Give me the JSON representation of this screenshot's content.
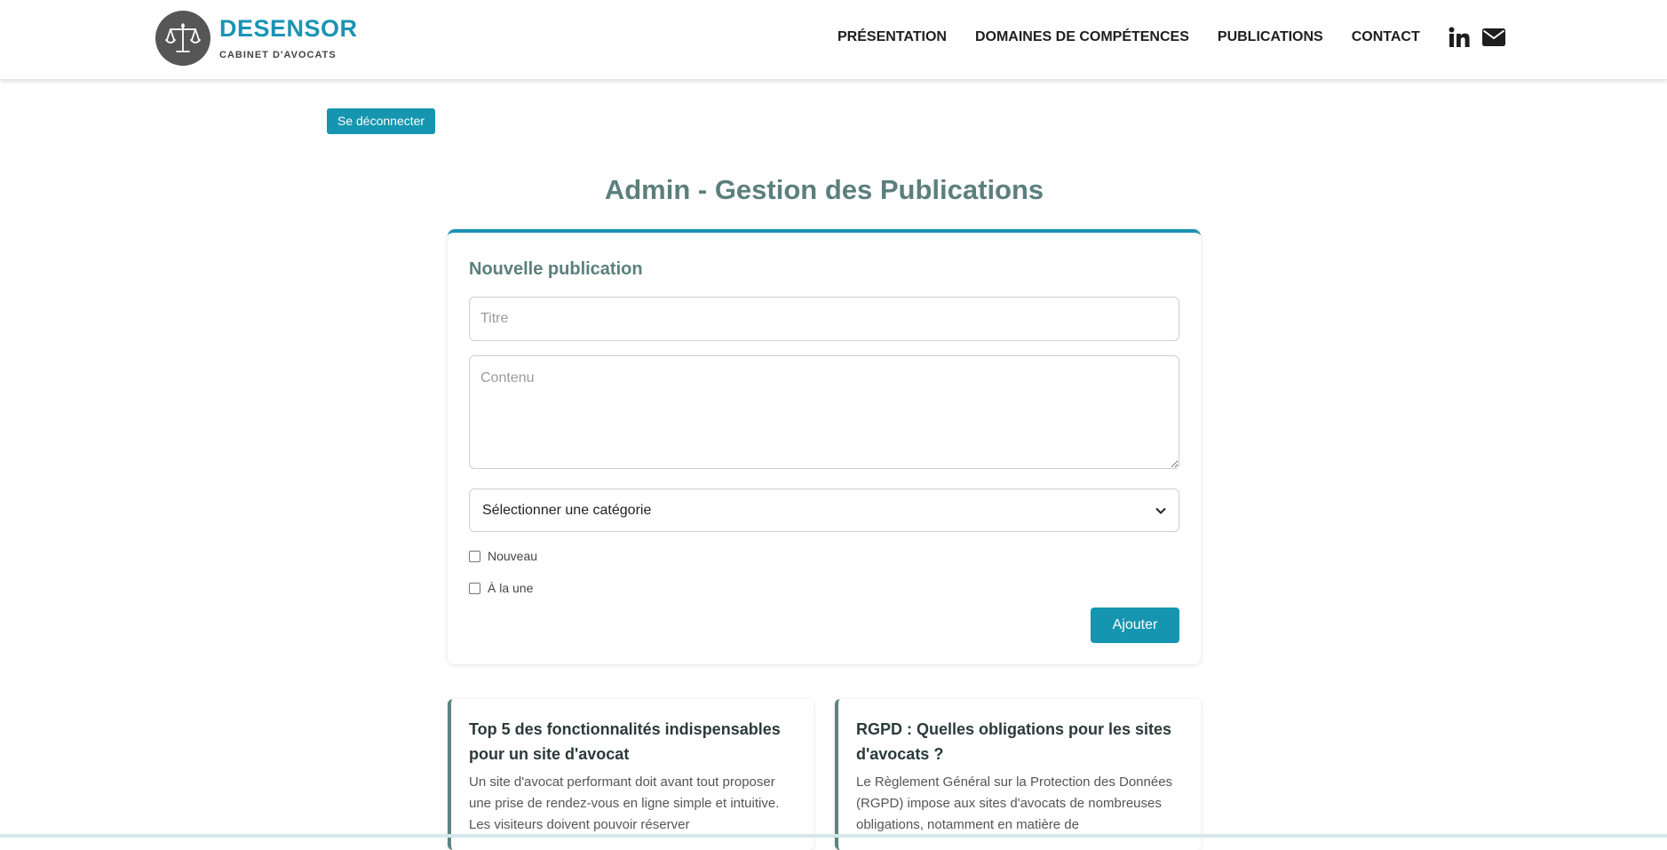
{
  "brand": {
    "name": "DESENSOR",
    "subtitle": "CABINET D'AVOCATS"
  },
  "nav": {
    "items": [
      "PRÉSENTATION",
      "DOMAINES DE COMPÉTENCES",
      "PUBLICATIONS",
      "CONTACT"
    ],
    "icons": [
      "linkedin-icon",
      "envelope-icon"
    ]
  },
  "logout": {
    "label": "Se déconnecter"
  },
  "page": {
    "title": "Admin - Gestion des Publications"
  },
  "form": {
    "heading": "Nouvelle publication",
    "title_placeholder": "Titre",
    "title_value": "",
    "content_placeholder": "Contenu",
    "content_value": "",
    "category_selected": "Sélectionner une catégorie",
    "checkbox_new": {
      "label": "Nouveau",
      "checked": false
    },
    "checkbox_featured": {
      "label": "À la une",
      "checked": false
    },
    "submit_label": "Ajouter"
  },
  "publications": [
    {
      "title": "Top 5 des fonctionnalités indispensables pour un site d'avocat",
      "excerpt": "Un site d'avocat performant doit avant tout proposer une prise de rendez-vous en ligne simple et intuitive. Les visiteurs doivent pouvoir réserver"
    },
    {
      "title": "RGPD : Quelles obligations pour les sites d'avocats ?",
      "excerpt": "Le Règlement Général sur la Protection des Données (RGPD) impose aux sites d'avocats de nombreuses obligations, notamment en matière de"
    }
  ],
  "colors": {
    "accent": "#1695b0",
    "heading": "#5b7f7d",
    "card_border": "#5b8481",
    "logo_bg": "#565656"
  }
}
